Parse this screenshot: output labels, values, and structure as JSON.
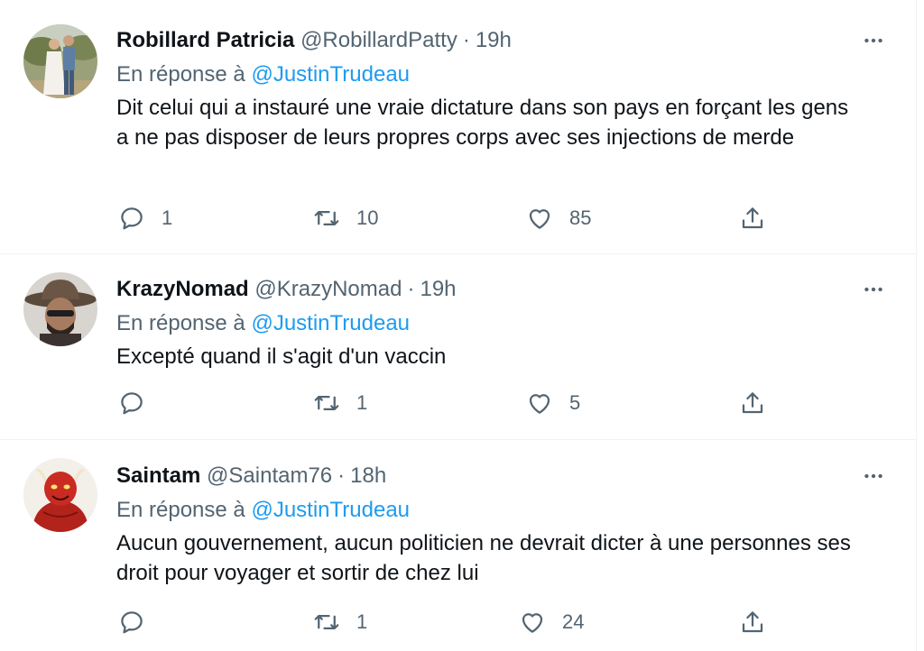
{
  "tweets": [
    {
      "name": "Robillard Patricia",
      "handle": "@RobillardPatty",
      "separator": "·",
      "time": "19h",
      "replying_prefix": "En réponse à",
      "replying_to": "@JustinTrudeau",
      "text": "Dit celui qui a instauré une vraie dictature dans son pays en forçant les gens a ne pas disposer de leurs propres corps avec ses injections de merde",
      "replies": "1",
      "retweets": "10",
      "likes": "85",
      "avatar_icon": "wedding-couple-photo"
    },
    {
      "name": "KrazyNomad",
      "handle": "@KrazyNomad",
      "separator": "·",
      "time": "19h",
      "replying_prefix": "En réponse à",
      "replying_to": "@JustinTrudeau",
      "text": "Excepté quand il s'agit d'un vaccin",
      "replies": "",
      "retweets": "1",
      "likes": "5",
      "avatar_icon": "cowboy-hat-man-photo"
    },
    {
      "name": "Saintam",
      "handle": "@Saintam76",
      "separator": "·",
      "time": "18h",
      "replying_prefix": "En réponse à",
      "replying_to": "@JustinTrudeau",
      "text": "Aucun gouvernement, aucun politicien ne devrait dicter à une personnes ses droit pour voyager et sortir de chez lui",
      "replies": "",
      "retweets": "1",
      "likes": "24",
      "avatar_icon": "red-devil-cartoon"
    }
  ],
  "colors": {
    "text": "#0f1419",
    "secondary": "#536471",
    "link": "#1d9bf0",
    "divider": "#eff3f4"
  },
  "icons": {
    "more": "more-horizontal-icon",
    "reply": "reply-icon",
    "retweet": "retweet-icon",
    "like": "heart-icon",
    "share": "share-icon"
  }
}
